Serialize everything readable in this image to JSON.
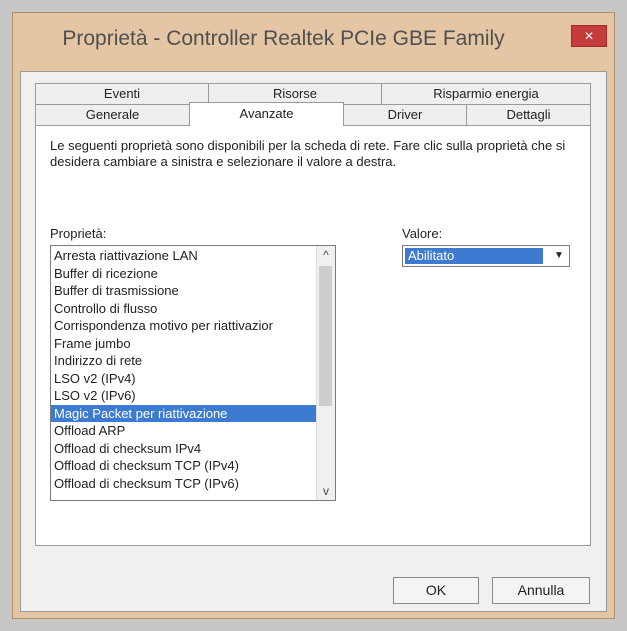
{
  "window": {
    "title": "Proprietà - Controller Realtek PCIe GBE Family",
    "close_label": "×"
  },
  "tabs": {
    "top": [
      "Eventi",
      "Risorse",
      "Risparmio energia"
    ],
    "bottom": [
      "Generale",
      "Avanzate",
      "Driver",
      "Dettagli"
    ],
    "active": "Avanzate"
  },
  "panel": {
    "description": "Le seguenti proprietà sono disponibili per la scheda di rete. Fare clic sulla proprietà che si desidera cambiare a sinistra e selezionare il valore a destra.",
    "property_label": "Proprietà:",
    "value_label": "Valore:",
    "properties": [
      "Arresta riattivazione LAN",
      "Buffer di ricezione",
      "Buffer di trasmissione",
      "Controllo di flusso",
      "Corrispondenza motivo per riattivazior",
      "Frame jumbo",
      "Indirizzo di rete",
      "LSO v2 (IPv4)",
      "LSO v2 (IPv6)",
      "Magic Packet per riattivazione",
      "Offload ARP",
      "Offload di checksum IPv4",
      "Offload di checksum TCP (IPv4)",
      "Offload di checksum TCP (IPv6)"
    ],
    "selected_property": "Magic Packet per riattivazione",
    "value": "Abilitato",
    "scroll_up": "^",
    "scroll_down": "v",
    "dropdown_arrow": "▼"
  },
  "buttons": {
    "ok": "OK",
    "cancel": "Annulla"
  },
  "colors": {
    "selection": "#3d7bd0",
    "titlebar": "#e4c6a4",
    "close": "#c43c3c"
  }
}
